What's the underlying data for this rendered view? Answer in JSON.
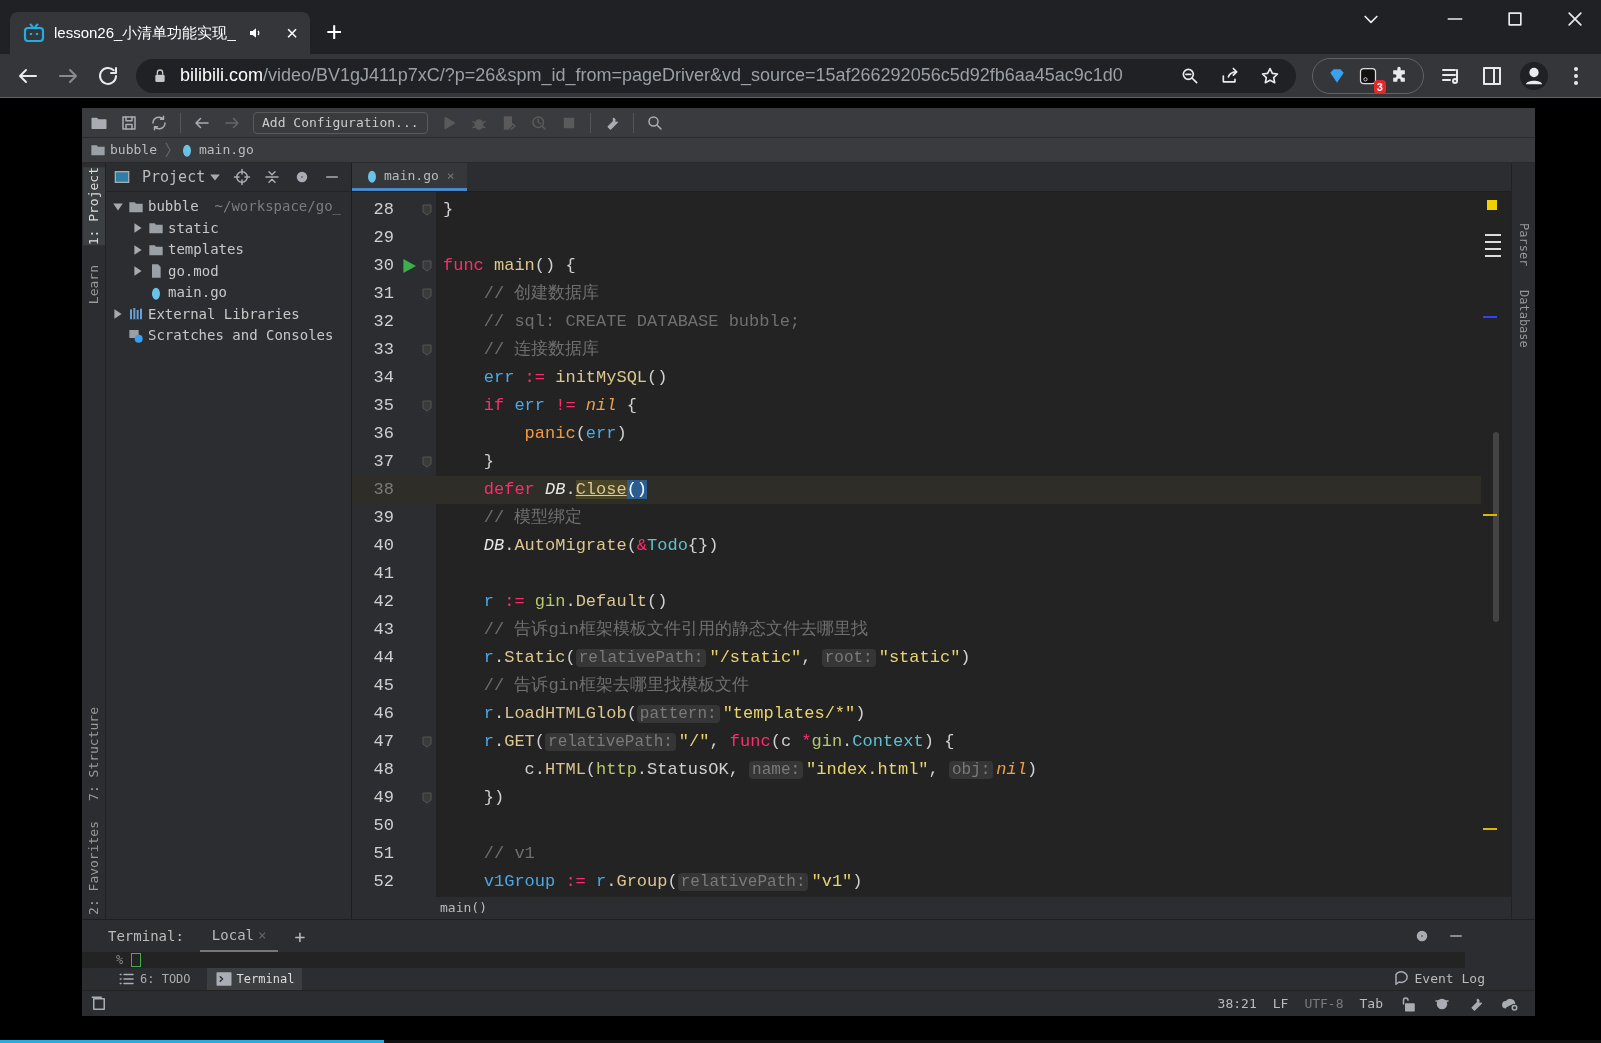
{
  "browser": {
    "tabs": [
      {
        "title": "lesson26_小清单功能实现_",
        "selected": true,
        "close": "×"
      }
    ],
    "new_tab": "+",
    "url_host": "bilibili.com",
    "url_path": "/video/BV1gJ411p7xC/?p=26&spm_id_from=pageDriver&vd_source=15af266292056c5d92fb6aa45ac9c1d0",
    "extension_badge": "3"
  },
  "ide": {
    "toolbar": {
      "run_config": "Add Configuration..."
    },
    "breadcrumbs": [
      "bubble",
      "main.go"
    ],
    "left_stripe": [
      {
        "label": "1: Project",
        "selected": true,
        "kind": "top"
      },
      {
        "label": "Learn",
        "selected": false,
        "kind": "top"
      },
      {
        "label": "7: Structure",
        "selected": false,
        "kind": "bottom"
      },
      {
        "label": "2: Favorites",
        "selected": false,
        "kind": "bottom"
      }
    ],
    "right_stripe": [
      "Parser",
      "Database"
    ],
    "project_panel": {
      "title": "Project",
      "tree": [
        {
          "label": "bubble",
          "hint": "~/workspace/go_",
          "kind": "folder",
          "expanded": true,
          "children": [
            {
              "label": "static",
              "kind": "folder",
              "expanded": false
            },
            {
              "label": "templates",
              "kind": "folder",
              "expanded": false
            },
            {
              "label": "go.mod",
              "kind": "mod",
              "expanded": false
            },
            {
              "label": "main.go",
              "kind": "go"
            }
          ]
        },
        {
          "label": "External Libraries",
          "kind": "lib",
          "expanded": false
        },
        {
          "label": "Scratches and Consoles",
          "kind": "scratch"
        }
      ]
    },
    "editor_tabs": [
      {
        "label": "main.go",
        "selected": true,
        "close": "×"
      }
    ],
    "lines": [
      {
        "n": "28",
        "current": false,
        "fold": true,
        "tokens": [
          {
            "kind": "plain",
            "text": "}"
          }
        ]
      },
      {
        "n": "29",
        "current": false
      },
      {
        "n": "30",
        "current": false,
        "fold": true,
        "run": true,
        "tokens": [
          {
            "kind": "kw",
            "text": "func"
          },
          {
            "kind": "method",
            "text": " main"
          },
          {
            "kind": "plain",
            "text": "() {"
          }
        ]
      },
      {
        "n": "31",
        "current": false,
        "fold": true,
        "tokens": [
          {
            "kind": "comment",
            "text": "    // 创建数据库"
          }
        ]
      },
      {
        "n": "32",
        "current": false,
        "tokens": [
          {
            "kind": "comment",
            "text": "    // sql: CREATE DATABASE bubble;"
          }
        ]
      },
      {
        "n": "33",
        "current": false,
        "fold": true,
        "tokens": [
          {
            "kind": "comment",
            "text": "    // 连接数据库"
          }
        ]
      },
      {
        "n": "34",
        "current": false,
        "tokens": [
          {
            "kind": "var",
            "text": "    err"
          },
          {
            "kind": "op",
            "text": " :="
          },
          {
            "kind": "method",
            "text": " initMySQL"
          },
          {
            "kind": "plain",
            "text": "()"
          }
        ]
      },
      {
        "n": "35",
        "current": false,
        "fold": true,
        "tokens": [
          {
            "kind": "kw",
            "text": "    if"
          },
          {
            "kind": "var",
            "text": " err"
          },
          {
            "kind": "op",
            "text": " !="
          },
          {
            "kind": "nil",
            "text": " nil"
          },
          {
            "kind": "plain",
            "text": " {"
          }
        ]
      },
      {
        "n": "36",
        "current": false,
        "tokens": [
          {
            "kind": "builtin",
            "text": "        panic"
          },
          {
            "kind": "plain",
            "text": "("
          },
          {
            "kind": "var",
            "text": "err"
          },
          {
            "kind": "plain",
            "text": ")"
          }
        ]
      },
      {
        "n": "37",
        "current": false,
        "fold": true,
        "tokens": [
          {
            "kind": "plain",
            "text": "    }"
          }
        ]
      },
      {
        "n": "38",
        "current": true,
        "tokens": [
          {
            "kind": "kw",
            "text": "    defer"
          },
          {
            "kind": "ital",
            "text": " DB"
          },
          {
            "kind": "plain",
            "text": "."
          },
          {
            "kind": "usage",
            "text": "Close"
          },
          {
            "kind": "brace",
            "text": "()"
          }
        ]
      },
      {
        "n": "39",
        "current": false,
        "tokens": [
          {
            "kind": "comment",
            "text": "    // 模型绑定"
          }
        ]
      },
      {
        "n": "40",
        "current": false,
        "tokens": [
          {
            "kind": "ital",
            "text": "    DB"
          },
          {
            "kind": "plain",
            "text": "."
          },
          {
            "kind": "method",
            "text": "AutoMigrate"
          },
          {
            "kind": "plain",
            "text": "("
          },
          {
            "kind": "op",
            "text": "&"
          },
          {
            "kind": "type",
            "text": "Todo"
          },
          {
            "kind": "plain",
            "text": "{})"
          }
        ]
      },
      {
        "n": "41",
        "current": false
      },
      {
        "n": "42",
        "current": false,
        "tokens": [
          {
            "kind": "var",
            "text": "    r"
          },
          {
            "kind": "op",
            "text": " :="
          },
          {
            "kind": "pkg",
            "text": " gin"
          },
          {
            "kind": "plain",
            "text": "."
          },
          {
            "kind": "method",
            "text": "Default"
          },
          {
            "kind": "plain",
            "text": "()"
          }
        ]
      },
      {
        "n": "43",
        "current": false,
        "tokens": [
          {
            "kind": "comment",
            "text": "    // 告诉gin框架模板文件引用的静态文件去哪里找"
          }
        ]
      },
      {
        "n": "44",
        "current": false,
        "tokens": [
          {
            "kind": "var",
            "text": "    r"
          },
          {
            "kind": "plain",
            "text": "."
          },
          {
            "kind": "method",
            "text": "Static"
          },
          {
            "kind": "plain",
            "text": "("
          },
          {
            "kind": "hint",
            "text": "relativePath:"
          },
          {
            "kind": "str",
            "text": "\"/static\""
          },
          {
            "kind": "plain",
            "text": ","
          },
          {
            "kind": "hint",
            "text": "root:"
          },
          {
            "kind": "str",
            "text": "\"static\""
          },
          {
            "kind": "plain",
            "text": ")"
          }
        ]
      },
      {
        "n": "45",
        "current": false,
        "tokens": [
          {
            "kind": "comment",
            "text": "    // 告诉gin框架去哪里找模板文件"
          }
        ]
      },
      {
        "n": "46",
        "current": false,
        "tokens": [
          {
            "kind": "var",
            "text": "    r"
          },
          {
            "kind": "plain",
            "text": "."
          },
          {
            "kind": "method",
            "text": "LoadHTMLGlob"
          },
          {
            "kind": "plain",
            "text": "("
          },
          {
            "kind": "hint",
            "text": "pattern:"
          },
          {
            "kind": "str",
            "text": "\"templates/*\""
          },
          {
            "kind": "plain",
            "text": ")"
          }
        ]
      },
      {
        "n": "47",
        "current": false,
        "fold": true,
        "tokens": [
          {
            "kind": "var",
            "text": "    r"
          },
          {
            "kind": "plain",
            "text": "."
          },
          {
            "kind": "method",
            "text": "GET"
          },
          {
            "kind": "plain",
            "text": "("
          },
          {
            "kind": "hint",
            "text": "relativePath:"
          },
          {
            "kind": "str",
            "text": "\"/\""
          },
          {
            "kind": "plain",
            "text": ","
          },
          {
            "kind": "kw",
            "text": " func"
          },
          {
            "kind": "plain",
            "text": "(c"
          },
          {
            "kind": "op",
            "text": " *"
          },
          {
            "kind": "pkg",
            "text": "gin"
          },
          {
            "kind": "plain",
            "text": "."
          },
          {
            "kind": "type",
            "text": "Context"
          },
          {
            "kind": "plain",
            "text": ") {"
          }
        ]
      },
      {
        "n": "48",
        "current": false,
        "tokens": [
          {
            "kind": "plain",
            "text": "        c."
          },
          {
            "kind": "method",
            "text": "HTML"
          },
          {
            "kind": "plain",
            "text": "("
          },
          {
            "kind": "pkg",
            "text": "http"
          },
          {
            "kind": "plain",
            "text": ".StatusOK,"
          },
          {
            "kind": "hint",
            "text": "name:"
          },
          {
            "kind": "str",
            "text": "\"index.html\""
          },
          {
            "kind": "plain",
            "text": ","
          },
          {
            "kind": "hint",
            "text": "obj:"
          },
          {
            "kind": "nil",
            "text": "nil"
          },
          {
            "kind": "plain",
            "text": ")"
          }
        ]
      },
      {
        "n": "49",
        "current": false,
        "fold": true,
        "tokens": [
          {
            "kind": "plain",
            "text": "    })"
          }
        ]
      },
      {
        "n": "50",
        "current": false
      },
      {
        "n": "51",
        "current": false,
        "tokens": [
          {
            "kind": "comment",
            "text": "    // v1"
          }
        ]
      },
      {
        "n": "52",
        "current": false,
        "tokens": [
          {
            "kind": "var",
            "text": "    v1Group"
          },
          {
            "kind": "op",
            "text": " :="
          },
          {
            "kind": "var",
            "text": " r"
          },
          {
            "kind": "plain",
            "text": "."
          },
          {
            "kind": "method",
            "text": "Group"
          },
          {
            "kind": "plain",
            "text": "("
          },
          {
            "kind": "hint",
            "text": "relativePath:"
          },
          {
            "kind": "str",
            "text": "\"v1\""
          },
          {
            "kind": "plain",
            "text": ")"
          }
        ]
      }
    ],
    "code_breadcrumb": "main()",
    "terminal": {
      "title": "Terminal:",
      "tabs": [
        {
          "label": "Local",
          "selected": true,
          "close": "×"
        }
      ],
      "add": "+",
      "prompt": "%"
    },
    "tool_tabs": [
      {
        "label": "6: TODO",
        "selected": false,
        "kind": "todo"
      },
      {
        "label": "Terminal",
        "selected": true,
        "kind": "terminal"
      }
    ],
    "event_log": "Event Log",
    "status": [
      "38:21",
      "LF",
      "UTF-8",
      "Tab"
    ]
  },
  "video_progress": {
    "level": 0.24
  }
}
